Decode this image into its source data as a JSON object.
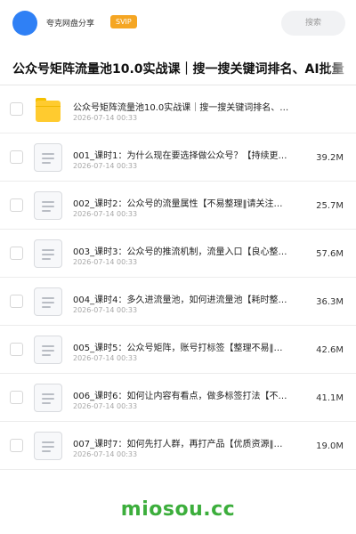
{
  "header": {
    "user_name": "夸克网盘分享",
    "badge": "SVIP",
    "search_placeholder": "搜索"
  },
  "page": {
    "title": "公众号矩阵流量池10.0实战课｜搜一搜关键词排名、AI批量"
  },
  "files": [
    {
      "type": "folder",
      "name": "公众号矩阵流量池10.0实战课｜搜一搜关键词排名、…",
      "date": "2026-07-14 00:33",
      "size": ""
    },
    {
      "type": "doc",
      "name": "001_课时1：为什么现在要选择做公众号？【持续更…",
      "date": "2026-07-14 00:33",
      "size": "39.2M"
    },
    {
      "type": "doc",
      "name": "002_课时2：公众号的流量属性【不易整理‖请关注…",
      "date": "2026-07-14 00:33",
      "size": "25.7M"
    },
    {
      "type": "doc",
      "name": "003_课时3：公众号的推流机制，流量入口【良心整…",
      "date": "2026-07-14 00:33",
      "size": "57.6M"
    },
    {
      "type": "doc",
      "name": "004_课时4：多久进流量池，如何进流量池【耗时整…",
      "date": "2026-07-14 00:33",
      "size": "36.3M"
    },
    {
      "type": "doc",
      "name": "005_课时5：公众号矩阵，账号打标签【整理不易‖…",
      "date": "2026-07-14 00:33",
      "size": "42.6M"
    },
    {
      "type": "doc",
      "name": "006_课时6：如何让内容有看点，做多标签打法【不…",
      "date": "2026-07-14 00:33",
      "size": "41.1M"
    },
    {
      "type": "doc",
      "name": "007_课时7：如何先打人群，再打产品【优质资源‖…",
      "date": "2026-07-14 00:33",
      "size": "19.0M"
    }
  ],
  "watermark": "miosou.cc",
  "colors": {
    "avatar": "#2f80f5",
    "badge": "#f5a623",
    "folder": "#ffcb2f",
    "watermark": "#3cae3c"
  }
}
